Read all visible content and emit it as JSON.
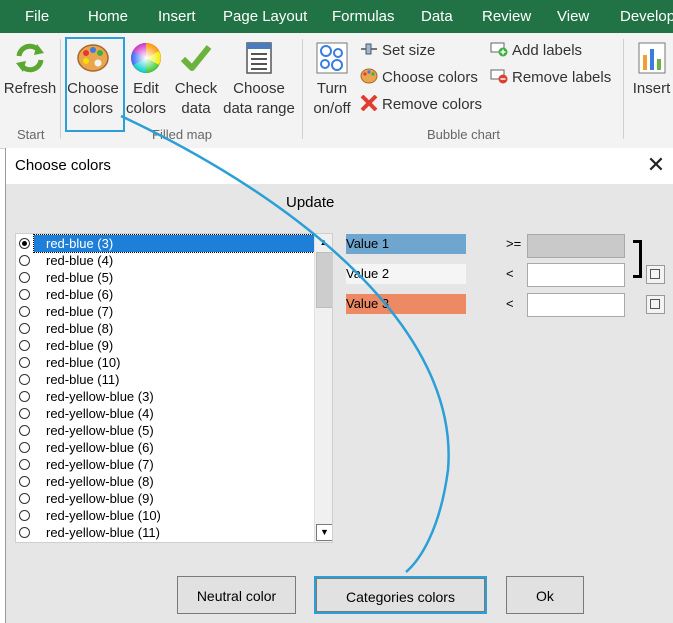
{
  "menu": {
    "tabs": [
      "File",
      "Home",
      "Insert",
      "Page Layout",
      "Formulas",
      "Data",
      "Review",
      "View",
      "Develop"
    ]
  },
  "ribbon": {
    "start": {
      "refresh": "Refresh",
      "group_label": "Start"
    },
    "filled_map": {
      "choose_colors_1": "Choose",
      "choose_colors_2": "colors",
      "edit_colors_1": "Edit",
      "edit_colors_2": "colors",
      "check_data_1": "Check",
      "check_data_2": "data",
      "choose_range_1": "Choose",
      "choose_range_2": "data range",
      "group_label": "Filled map"
    },
    "bubble_chart": {
      "turn_1": "Turn",
      "turn_2": "on/off",
      "set_size": "Set size",
      "choose_colors": "Choose colors",
      "remove_colors": "Remove colors",
      "add_labels": "Add labels",
      "remove_labels": "Remove labels",
      "group_label": "Bubble chart"
    },
    "insert": "Insert"
  },
  "dialog": {
    "title": "Choose colors",
    "update": "Update",
    "schemes": [
      "red-blue (3)",
      "red-blue (4)",
      "red-blue (5)",
      "red-blue (6)",
      "red-blue (7)",
      "red-blue (8)",
      "red-blue (9)",
      "red-blue (10)",
      "red-blue (11)",
      "red-yellow-blue (3)",
      "red-yellow-blue (4)",
      "red-yellow-blue (5)",
      "red-yellow-blue (6)",
      "red-yellow-blue (7)",
      "red-yellow-blue (8)",
      "red-yellow-blue (9)",
      "red-yellow-blue (10)",
      "red-yellow-blue (11)"
    ],
    "selected_index": 0,
    "values": [
      {
        "label": "Value 1",
        "color": "#6ea6d0",
        "op": ">="
      },
      {
        "label": "Value 2",
        "color": "#f5f5f5",
        "op": "<"
      },
      {
        "label": "Value 3",
        "color": "#ed8a63",
        "op": "<"
      }
    ],
    "buttons": {
      "neutral": "Neutral color",
      "categories": "Categories colors",
      "ok": "Ok"
    }
  },
  "colors": {
    "title_bar": "#217346",
    "highlight": "#2b9fd6",
    "selection": "#1e7fd8"
  }
}
